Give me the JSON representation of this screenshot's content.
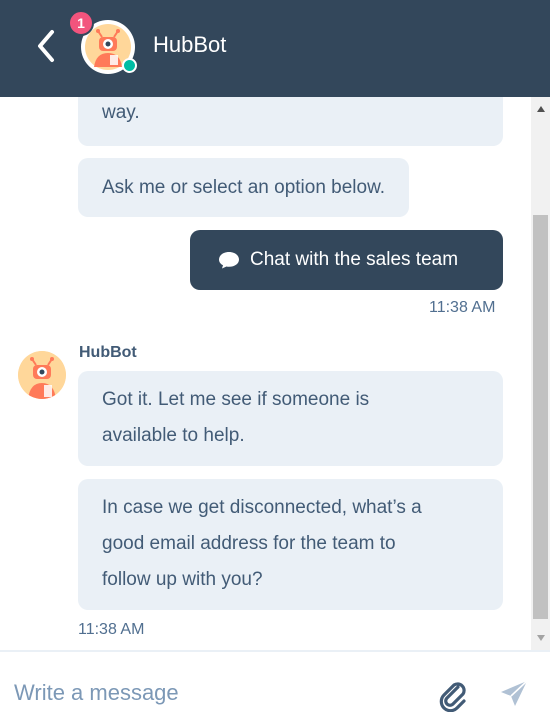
{
  "header": {
    "bot_name": "HubBot",
    "badge_count": "1",
    "status": "online"
  },
  "messages": {
    "bot_partial": "way.",
    "bot_prompt": "Ask me or select an option below.",
    "user_choice": "Chat with the sales team",
    "user_time": "11:38 AM",
    "bot_name": "HubBot",
    "bot_reply_1_line1": "Got it. Let me see if someone is",
    "bot_reply_1_line2": "available to help.",
    "bot_reply_2_line1": "In case we get disconnected, what’s a",
    "bot_reply_2_line2": "good email address for the team to",
    "bot_reply_2_line3": "follow up with you?",
    "bot_time": "11:38 AM"
  },
  "composer": {
    "placeholder": "Write a message"
  },
  "colors": {
    "header_bg": "#33475b",
    "bubble_bg": "#eaf0f6",
    "badge": "#f2547d",
    "online": "#00bda5",
    "bot_avatar": "#ffd79a"
  },
  "icons": {
    "back": "chevron-left-icon",
    "chat": "chat-bubble-icon",
    "attach": "paperclip-icon",
    "send": "send-icon"
  }
}
